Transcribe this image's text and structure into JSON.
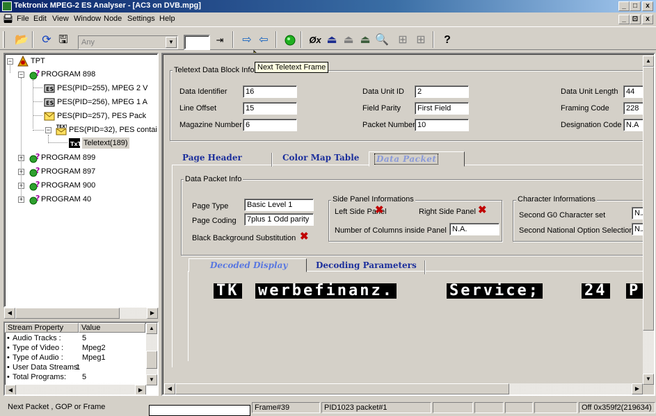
{
  "window": {
    "title": "Tektronix MPEG-2 ES Analyser - [AC3 on DVB.mpg]",
    "controls": [
      "_",
      "□",
      "x"
    ],
    "child_controls": [
      "_",
      "⊡",
      "x"
    ]
  },
  "menu": {
    "items": [
      "File",
      "Edit",
      "View",
      "Window",
      "Node",
      "Settings",
      "Help"
    ]
  },
  "toolbar": {
    "filter_placeholder": "Any",
    "nav_input_value": "",
    "tooltip": "Next Teletext Frame"
  },
  "tree": {
    "root": "TPT",
    "program_898": "PROGRAM 898",
    "pes_255": "PES(PID=255), MPEG 2 V",
    "pes_256": "PES(PID=256), MPEG 1 A",
    "pes_257": "PES(PID=257), PES Pack",
    "pes_32": "PES(PID=32), PES contair",
    "teletext": "Teletext(189)",
    "program_899": "PROGRAM 899",
    "program_897": "PROGRAM 897",
    "program_900": "PROGRAM 900",
    "program_40": "PROGRAM 40"
  },
  "properties": {
    "headers": [
      "Stream Property",
      "Value"
    ],
    "rows": [
      {
        "name": "Audio Tracks :",
        "value": "5"
      },
      {
        "name": "Type of Video :",
        "value": "Mpeg2"
      },
      {
        "name": "Type of Audio :",
        "value": "Mpeg1"
      },
      {
        "name": "User Data Streams:",
        "value": "1"
      },
      {
        "name": "Total Programs:",
        "value": "5"
      }
    ]
  },
  "block_info": {
    "title": "Teletext Data Block Info",
    "data_identifier_label": "Data Identifier",
    "data_identifier": "16",
    "line_offset_label": "Line Offset",
    "line_offset": "15",
    "magazine_number_label": "Magazine Number",
    "magazine_number": "6",
    "data_unit_id_label": "Data Unit ID",
    "data_unit_id": "2",
    "field_parity_label": "Field Parity",
    "field_parity": "First Field",
    "packet_number_label": "Packet Number",
    "packet_number": "10",
    "data_unit_length_label": "Data Unit Length",
    "data_unit_length": "44",
    "framing_code_label": "Framing Code",
    "framing_code": "228",
    "designation_code_label": "Designation Code",
    "designation_code": "N.A"
  },
  "tabs": {
    "page_header": "Page Header",
    "color_map_table": "Color Map Table",
    "data_packet": "Data Packet"
  },
  "data_packet": {
    "group_title": "Data Packet Info",
    "page_type_label": "Page Type",
    "page_type": "Basic Level 1",
    "page_coding_label": "Page Coding",
    "page_coding": "7plus 1 Odd parity",
    "black_bg_label": "Black Background Substitution",
    "side_panel_title": "Side Panel Informations",
    "left_side_panel_label": "Left Side Panel",
    "right_side_panel_label": "Right Side Panel",
    "columns_inside_label": "Number of Columns inside Panel",
    "columns_inside": "N.A.",
    "char_info_title": "Character Informations",
    "second_g0_label": "Second G0 Character set",
    "second_g0": "N.A",
    "second_national_label": "Second National Option Selection",
    "second_national": "N.A"
  },
  "subtabs": {
    "decoded_display": "Decoded Display",
    "decoding_parameters": "Decoding Parameters"
  },
  "teletext_display": {
    "segments": [
      "TK",
      "werbefinanz.",
      "Service;",
      "24",
      "P"
    ]
  },
  "statusbar": {
    "hint": "Next Packet , GOP or Frame",
    "box": "",
    "frame": "Frame#39",
    "pid_packet": "PID1023 packet#1",
    "offset": "Off 0x359f2(219634)"
  }
}
